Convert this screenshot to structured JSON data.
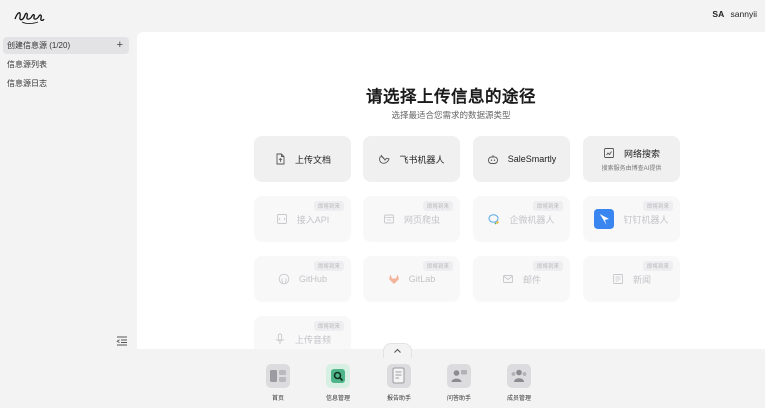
{
  "user": {
    "avatar": "SA",
    "name": "sannyii"
  },
  "sidebar": {
    "items": [
      {
        "label": "创建信息源 (1/20)",
        "action": "+"
      },
      {
        "label": "信息源列表"
      },
      {
        "label": "信息源日志"
      }
    ]
  },
  "main": {
    "title": "请选择上传信息的途径",
    "subtitle": "选择最适合您需求的数据源类型",
    "cards": [
      {
        "label": "上传文档",
        "icon": "document-icon"
      },
      {
        "label": "飞书机器人",
        "icon": "feishu-bot-icon"
      },
      {
        "label": "SaleSmartly",
        "icon": "bot-icon"
      },
      {
        "label": "网络搜索",
        "sub": "搜索服务由博查AI提供",
        "icon": "web-search-icon"
      },
      {
        "label": "接入API",
        "badge": "即将到来",
        "icon": "api-icon"
      },
      {
        "label": "网页爬虫",
        "badge": "即将到来",
        "icon": "web-crawler-icon"
      },
      {
        "label": "企微机器人",
        "badge": "即将到来",
        "icon": "wecom-icon"
      },
      {
        "label": "钉钉机器人",
        "badge": "即将到来",
        "icon": "dingtalk-icon"
      },
      {
        "label": "GitHub",
        "badge": "即将到来",
        "icon": "github-icon"
      },
      {
        "label": "GitLab",
        "badge": "即将到来",
        "icon": "gitlab-icon"
      },
      {
        "label": "邮件",
        "badge": "即将到来",
        "icon": "mail-icon"
      },
      {
        "label": "新闻",
        "badge": "即将到来",
        "icon": "news-icon"
      },
      {
        "label": "上传音频",
        "badge": "即将到来",
        "icon": "microphone-icon"
      }
    ]
  },
  "dock": {
    "items": [
      {
        "label": "首页",
        "icon": "home-icon"
      },
      {
        "label": "信息管理",
        "icon": "info-search-icon"
      },
      {
        "label": "报告助手",
        "icon": "report-icon"
      },
      {
        "label": "问答助手",
        "icon": "qa-icon"
      },
      {
        "label": "成员管理",
        "icon": "members-icon"
      }
    ]
  },
  "colors": {
    "accent_green": "#4eb589",
    "dingtalk_blue": "#3a86f0",
    "gitlab_orange": "#e8693d"
  }
}
